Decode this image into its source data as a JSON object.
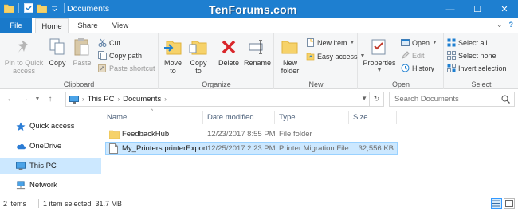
{
  "window": {
    "title": "Documents",
    "watermark": "TenForums.com",
    "minimize": "—",
    "maximize": "☐",
    "close": "✕"
  },
  "tabs": [
    "File",
    "Home",
    "Share",
    "View"
  ],
  "ribbon": {
    "clipboard": {
      "pin_quick_access": "Pin to Quick\naccess",
      "copy": "Copy",
      "paste": "Paste",
      "cut": "Cut",
      "copy_path": "Copy path",
      "paste_shortcut": "Paste shortcut",
      "label": "Clipboard"
    },
    "organize": {
      "move_to": "Move\nto",
      "copy_to": "Copy\nto",
      "delete": "Delete",
      "rename": "Rename",
      "label": "Organize"
    },
    "new": {
      "new_folder": "New\nfolder",
      "new_item": "New item",
      "easy_access": "Easy access",
      "label": "New"
    },
    "open": {
      "properties": "Properties",
      "open": "Open",
      "edit": "Edit",
      "history": "History",
      "label": "Open"
    },
    "select": {
      "select_all": "Select all",
      "select_none": "Select none",
      "invert_selection": "Invert selection",
      "label": "Select"
    }
  },
  "address": {
    "segments": [
      "This PC",
      "Documents"
    ],
    "search_placeholder": "Search Documents"
  },
  "nav_pane": {
    "items": [
      {
        "label": "Quick access",
        "icon": "star-icon"
      },
      {
        "label": "OneDrive",
        "icon": "cloud-icon"
      },
      {
        "label": "This PC",
        "icon": "computer-icon",
        "selected": true
      },
      {
        "label": "Network",
        "icon": "network-icon"
      }
    ]
  },
  "file_list": {
    "columns": [
      "Name",
      "Date modified",
      "Type",
      "Size"
    ],
    "rows": [
      {
        "name": "FeedbackHub",
        "date": "12/23/2017 8:55 PM",
        "type": "File folder",
        "size": "",
        "icon": "folder-icon",
        "selected": false
      },
      {
        "name": "My_Printers.printerExport",
        "date": "12/25/2017 2:23 PM",
        "type": "Printer Migration File",
        "size": "32,556 KB",
        "icon": "file-icon",
        "selected": true
      }
    ]
  },
  "status": {
    "count": "2 items",
    "selection": "1 item selected  31.7 MB"
  },
  "colors": {
    "titlebar": "#1e7fd0",
    "file_tab": "#1979ca",
    "selection": "#cce8ff"
  }
}
